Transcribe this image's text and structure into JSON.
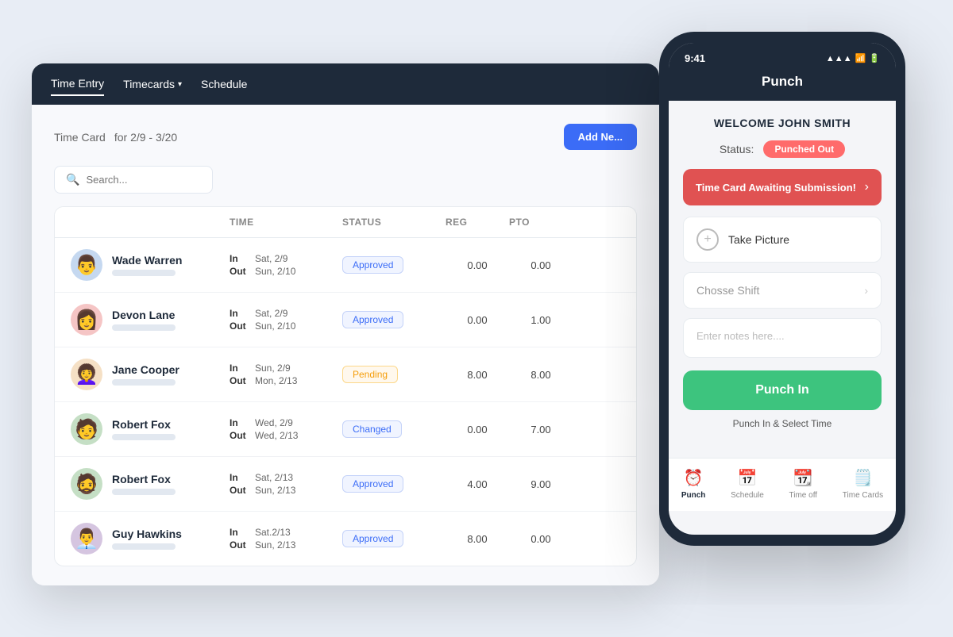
{
  "desktop": {
    "nav": {
      "items": [
        {
          "label": "Time Entry",
          "active": true,
          "has_dropdown": false
        },
        {
          "label": "Timecards",
          "active": false,
          "has_dropdown": true
        },
        {
          "label": "Schedule",
          "active": false,
          "has_dropdown": false
        }
      ]
    },
    "page_title": "Time Card",
    "date_range": "for 2/9 - 3/20",
    "add_button": "Add Ne...",
    "search_placeholder": "Search...",
    "table": {
      "headers": [
        "",
        "Time",
        "Status",
        "Reg",
        "PTO",
        ""
      ],
      "rows": [
        {
          "name": "Wade Warren",
          "avatar_emoji": "👨",
          "time_in": "Sat, 2/9",
          "time_out": "Sun, 2/10",
          "status": "Approved",
          "status_class": "approved",
          "reg": "0.00",
          "pto": "0.00"
        },
        {
          "name": "Devon Lane",
          "avatar_emoji": "👩",
          "time_in": "Sat, 2/9",
          "time_out": "Sun, 2/10",
          "status": "Approved",
          "status_class": "approved",
          "reg": "0.00",
          "pto": "1.00"
        },
        {
          "name": "Jane Cooper",
          "avatar_emoji": "👩‍🦱",
          "time_in": "Sun, 2/9",
          "time_out": "Mon, 2/13",
          "status": "Pending",
          "status_class": "pending",
          "reg": "8.00",
          "pto": "8.00"
        },
        {
          "name": "Robert Fox",
          "avatar_emoji": "🧑",
          "time_in": "Wed, 2/9",
          "time_out": "Wed, 2/13",
          "status": "Changed",
          "status_class": "changed",
          "reg": "0.00",
          "pto": "7.00"
        },
        {
          "name": "Robert Fox",
          "avatar_emoji": "🧔",
          "time_in": "Sat, 2/13",
          "time_out": "Sun, 2/13",
          "status": "Approved",
          "status_class": "approved",
          "reg": "4.00",
          "pto": "9.00"
        },
        {
          "name": "Guy Hawkins",
          "avatar_emoji": "👨‍💼",
          "time_in": "Sat.2/13",
          "time_out": "Sun, 2/13",
          "status": "Approved",
          "status_class": "approved",
          "reg": "8.00",
          "pto": "0.00"
        }
      ]
    }
  },
  "mobile": {
    "statusbar": {
      "time": "9:41",
      "signal": "▲▲▲",
      "wifi": "WiFi",
      "battery": "🔋"
    },
    "title": "Punch",
    "welcome": "WELCOME JOHN SMITH",
    "status_label": "Status:",
    "status_value": "Punched Out",
    "alert_text": "Time Card Awaiting Submission!",
    "take_picture": "Take Picture",
    "choose_shift": "Chosse Shift",
    "notes_placeholder": "Enter notes here....",
    "punch_in_button": "Punch In",
    "punch_select_time": "Punch In & Select Time",
    "bottom_nav": [
      {
        "label": "Punch",
        "active": true,
        "icon": "⏰"
      },
      {
        "label": "Schedule",
        "active": false,
        "icon": "📅"
      },
      {
        "label": "Time off",
        "active": false,
        "icon": "📆"
      },
      {
        "label": "Time Cards",
        "active": false,
        "icon": "🗒️"
      }
    ]
  }
}
